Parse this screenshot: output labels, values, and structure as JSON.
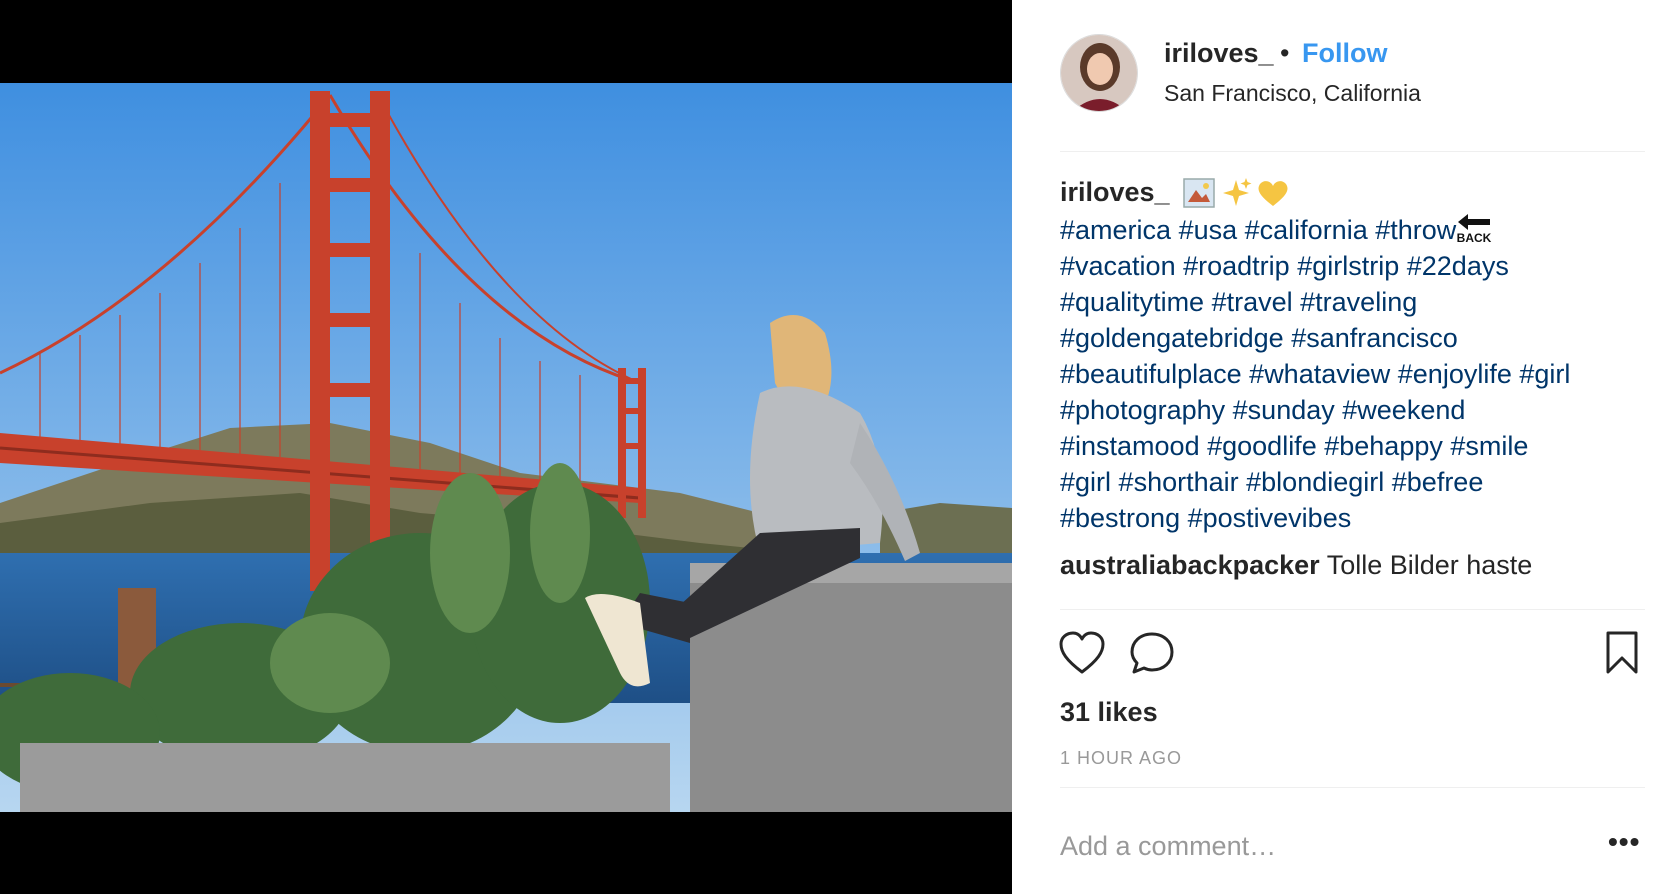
{
  "post": {
    "username": "iriloves_",
    "separator": "•",
    "follow_label": "Follow",
    "location": "San Francisco, California"
  },
  "caption": {
    "username": "iriloves_",
    "emojis": "framed-picture, sparkles, yellow-heart",
    "hashtag_lines": [
      [
        "#america",
        "#usa",
        "#california",
        "#throw"
      ],
      [
        "#vacation",
        "#roadtrip",
        "#girlstrip",
        "#22days"
      ],
      [
        "#qualitytime",
        "#travel",
        "#traveling"
      ],
      [
        "#goldengatebridge",
        "#sanfrancisco"
      ],
      [
        "#beautifulplace",
        "#whataview",
        "#enjoylife",
        "#girl"
      ],
      [
        "#photography",
        "#sunday",
        "#weekend"
      ],
      [
        "#instamood",
        "#goodlife",
        "#behappy",
        "#smile"
      ],
      [
        "#girl",
        "#shorthair",
        "#blondiegirl",
        "#befree"
      ],
      [
        "#bestrong",
        "#postivevibes"
      ]
    ],
    "back_badge": "BACK"
  },
  "comments": [
    {
      "username": "australiabackpacker",
      "text": "Tolle Bilder haste"
    }
  ],
  "actions": {
    "like_icon": "heart-outline-icon",
    "comment_icon": "speech-bubble-icon",
    "save_icon": "bookmark-icon"
  },
  "likes_text": "31 likes",
  "timestamp": "1 HOUR AGO",
  "add_comment_placeholder": "Add a comment…",
  "more_label": "•••",
  "colors": {
    "link_blue": "#3897f0",
    "hashtag": "#003569",
    "muted": "#999999",
    "bridge": "#c8412c",
    "sky": "#8fc0ec"
  }
}
